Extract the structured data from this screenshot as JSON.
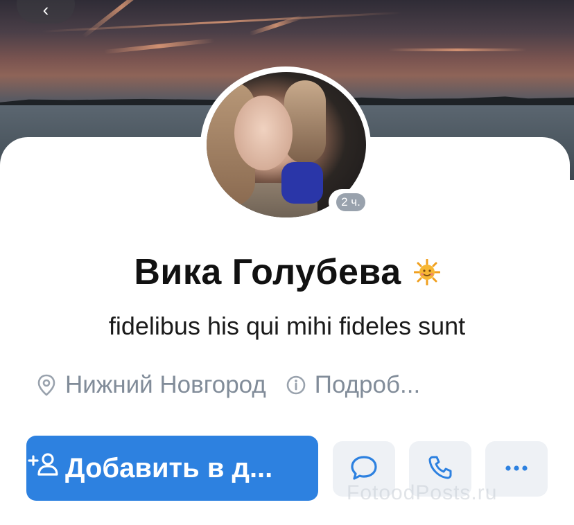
{
  "profile": {
    "name": "Вика Голубева",
    "status": "fidelibus his qui mihi fideles sunt",
    "online_ago": "2 ч.",
    "location": "Нижний Новгород",
    "details_label": "Подроб..."
  },
  "actions": {
    "add_friend_label": "Добавить в д..."
  },
  "icons": {
    "back": "chevron-left-icon",
    "location": "location-pin-icon",
    "details": "info-icon",
    "add_friend": "add-friend-icon",
    "message": "message-icon",
    "call": "phone-icon",
    "more": "more-icon",
    "name_emoji": "sun-emoji-icon"
  },
  "colors": {
    "accent": "#2d81e0",
    "secondary_text": "#818c99",
    "secondary_button": "#eef1f5"
  },
  "watermark": "FotoodPosts.ru"
}
